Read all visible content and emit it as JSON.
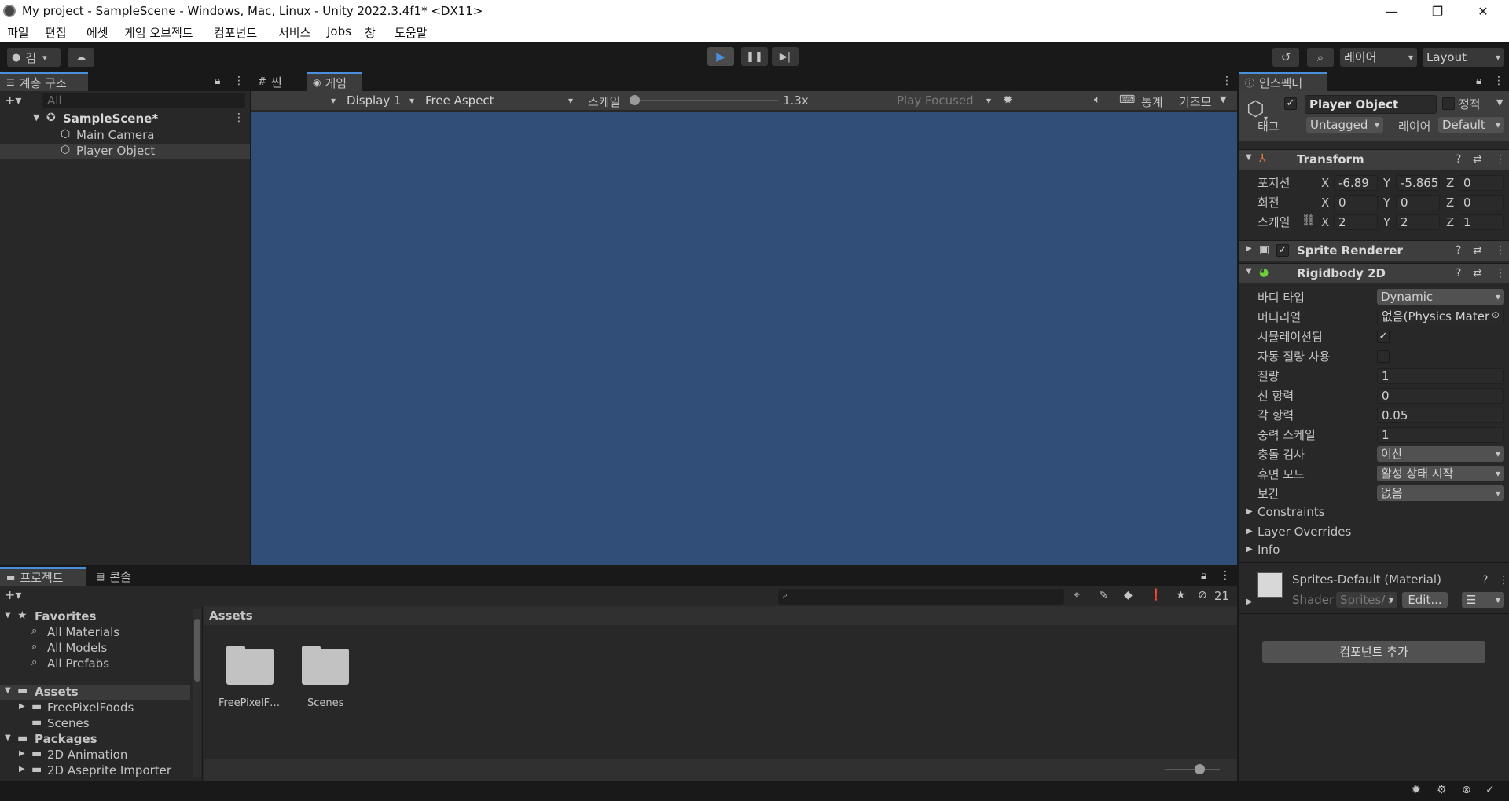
{
  "window": {
    "title": "My project - SampleScene - Windows, Mac, Linux - Unity 2022.3.4f1* <DX11>",
    "controls": {
      "minimize": "—",
      "restore": "❐",
      "close": "✕"
    }
  },
  "menu": [
    "파일",
    "편집",
    "에셋",
    "게임 오브젝트",
    "컴포넌트",
    "서비스",
    "Jobs",
    "창",
    "도움말"
  ],
  "toolbar": {
    "account": "김",
    "layer_dropdown": "레이어",
    "layout_dropdown": "Layout"
  },
  "hierarchy": {
    "tab": "계층 구조",
    "search_placeholder": "All",
    "scene": "SampleScene*",
    "items": [
      "Main Camera",
      "Player Object"
    ]
  },
  "scene_tabs": {
    "scene": "씬",
    "game": "게임"
  },
  "game_toolbar": {
    "display": "Display 1",
    "aspect": "Free Aspect",
    "scale_label": "스케일",
    "scale_value": "1.3x",
    "scale_fraction": 0.0,
    "play_focused": "Play Focused",
    "stats": "통계",
    "gizmos": "기즈모"
  },
  "colors": {
    "game_view": "#304e78",
    "accent": "#4a8fdc"
  },
  "inspector": {
    "tab": "인스펙터",
    "object_name": "Player Object",
    "static_label": "정적",
    "tag_label": "태그",
    "tag_value": "Untagged",
    "layer_label": "레이어",
    "layer_value": "Default",
    "transform": {
      "title": "Transform",
      "position_label": "포지션",
      "rotation_label": "회전",
      "scale_label": "스케일",
      "position": {
        "x": "-6.89",
        "y": "-5.865",
        "z": "0"
      },
      "rotation": {
        "x": "0",
        "y": "0",
        "z": "0"
      },
      "scale": {
        "x": "2",
        "y": "2",
        "z": "1"
      }
    },
    "sprite_renderer": {
      "title": "Sprite Renderer"
    },
    "rigidbody": {
      "title": "Rigidbody 2D",
      "body_type_label": "바디 타입",
      "body_type": "Dynamic",
      "material_label": "머티리얼",
      "material": "없음(Physics Mater",
      "simulated_label": "시뮬레이션됨",
      "auto_mass_label": "자동 질량 사용",
      "mass_label": "질량",
      "mass": "1",
      "linear_drag_label": "선 항력",
      "linear_drag": "0",
      "angular_drag_label": "각 항력",
      "angular_drag": "0.05",
      "gravity_label": "중력 스케일",
      "gravity": "1",
      "collision_label": "충돌 검사",
      "collision": "이산",
      "sleep_label": "휴면 모드",
      "sleep": "활성 상태 시작",
      "interp_label": "보간",
      "interp": "없음",
      "constraints": "Constraints",
      "layer_overrides": "Layer Overrides",
      "info": "Info"
    },
    "material": {
      "name": "Sprites-Default (Material)",
      "shader_label": "Shader",
      "shader_value": "Sprites/↓",
      "edit": "Edit..."
    },
    "add_component": "컴포넌트 추가"
  },
  "project": {
    "tab_project": "프로젝트",
    "tab_console": "콘솔",
    "hidden_count": "21",
    "favorites": "Favorites",
    "fav_items": [
      "All Materials",
      "All Models",
      "All Prefabs"
    ],
    "assets": "Assets",
    "asset_folders": [
      "FreePixelFoods",
      "Scenes"
    ],
    "packages": "Packages",
    "package_items": [
      "2D Animation",
      "2D Aseprite Importer"
    ],
    "breadcrumb": "Assets",
    "grid_items": [
      "FreePixelF…",
      "Scenes"
    ]
  }
}
